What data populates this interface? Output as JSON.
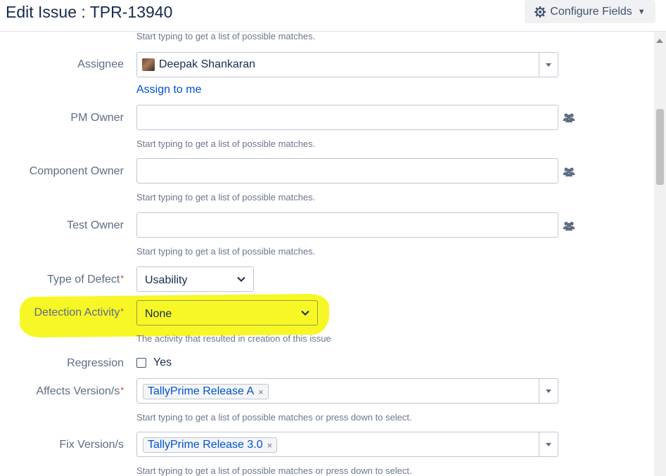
{
  "header": {
    "title": "Edit Issue : TPR-13940",
    "configure_label": "Configure Fields"
  },
  "hints": {
    "user_picker": "Start typing to get a list of possible matches.",
    "detection_activity": "The activity that resulted in creation of this issue",
    "versions": "Start typing to get a list of possible matches or press down to select."
  },
  "fields": {
    "assignee": {
      "label": "Assignee",
      "value": "Deepak Shankaran",
      "assign_link": "Assign to me"
    },
    "pm_owner": {
      "label": "PM Owner",
      "value": ""
    },
    "component_owner": {
      "label": "Component Owner",
      "value": ""
    },
    "test_owner": {
      "label": "Test Owner",
      "value": ""
    },
    "type_of_defect": {
      "label": "Type of Defect",
      "required_mark": "*",
      "value": "Usability"
    },
    "detection_activity": {
      "label": "Detection Activity",
      "required_mark": "*",
      "value": "None",
      "highlight_color": "#f7f726"
    },
    "regression": {
      "label": "Regression",
      "option": "Yes",
      "checked": false
    },
    "affects_versions": {
      "label": "Affects Version/s",
      "required_mark": "*",
      "tag": "TallyPrime Release A",
      "remove": "×"
    },
    "fix_versions": {
      "label": "Fix Version/s",
      "tag": "TallyPrime Release 3.0",
      "remove": "×"
    }
  },
  "icons": {
    "configure": "gear-icon",
    "user_picker": "users-group-icon",
    "dropdown": "chevron-down-icon"
  },
  "colors": {
    "link": "#0052cc",
    "required": "#de350b",
    "label": "#5e6c84"
  }
}
